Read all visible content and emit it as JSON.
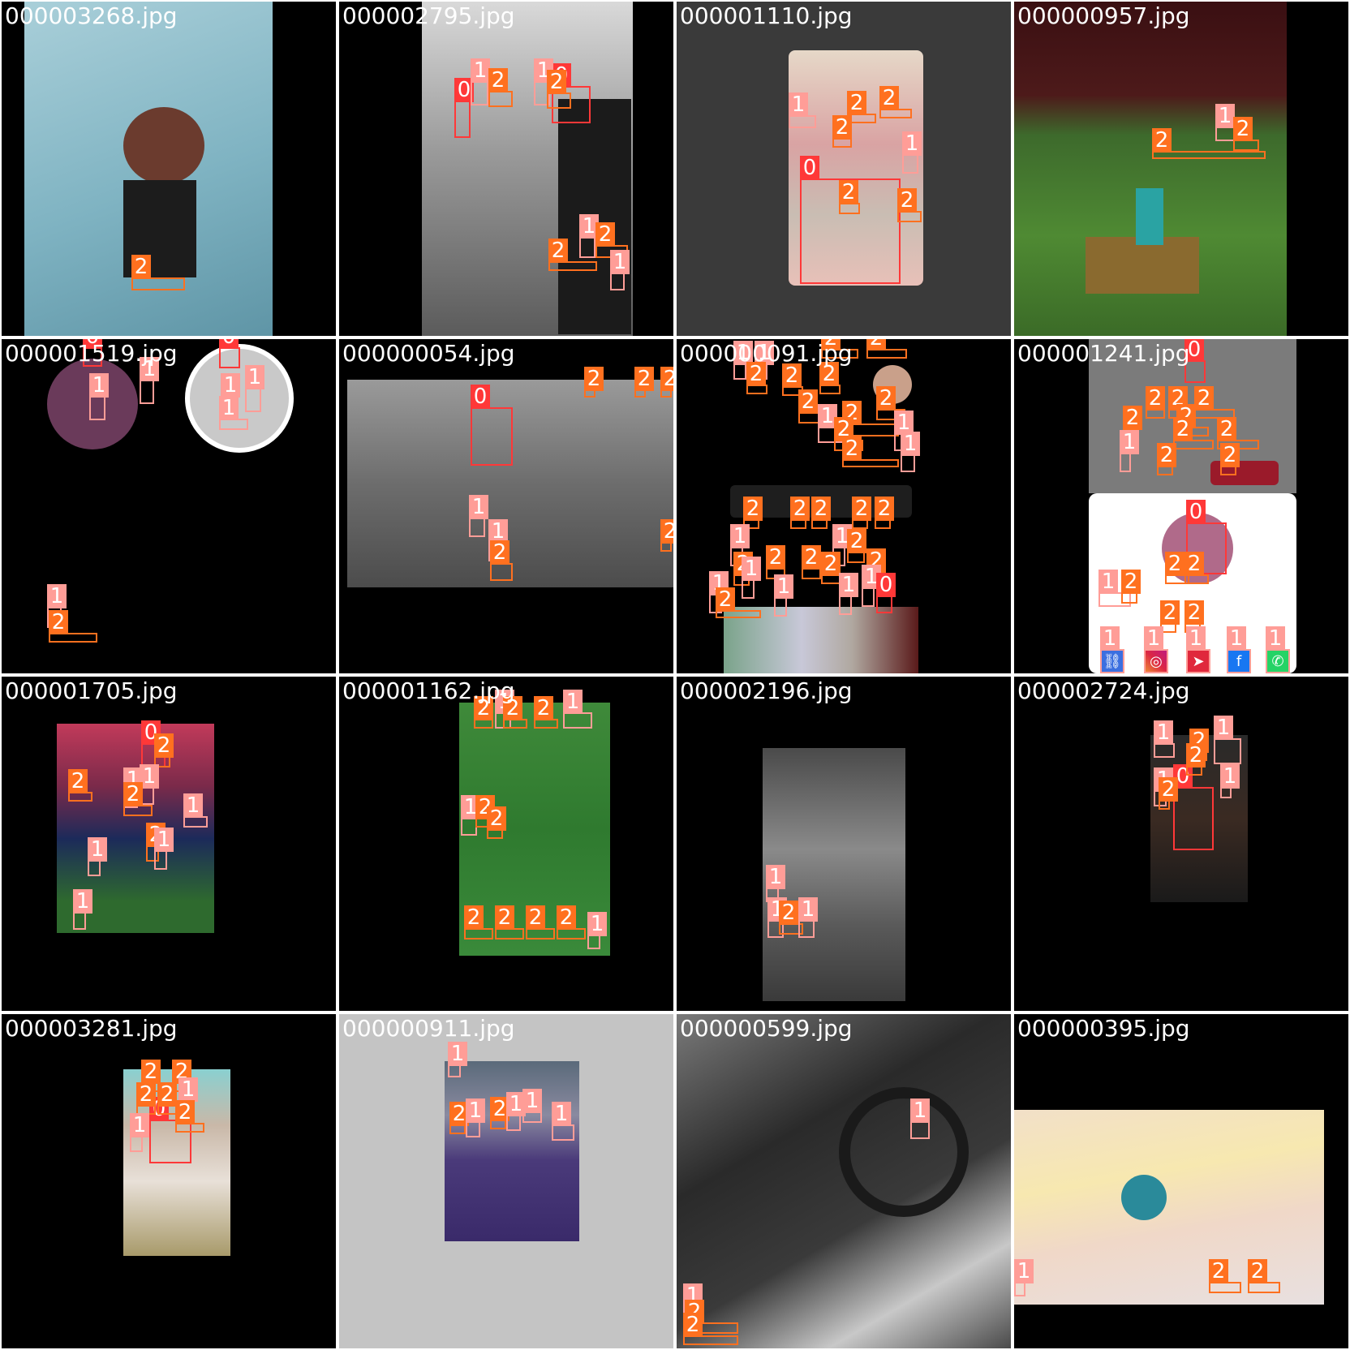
{
  "grid": {
    "tiles": [
      {
        "filename": "000003268.jpg"
      },
      {
        "filename": "000002795.jpg"
      },
      {
        "filename": "000001110.jpg"
      },
      {
        "filename": "000000957.jpg"
      },
      {
        "filename": "000001519.jpg"
      },
      {
        "filename": "000000054.jpg"
      },
      {
        "filename": "000000091.jpg"
      },
      {
        "filename": "000001241.jpg"
      },
      {
        "filename": "000001705.jpg"
      },
      {
        "filename": "000001162.jpg"
      },
      {
        "filename": "000002196.jpg"
      },
      {
        "filename": "000002724.jpg"
      },
      {
        "filename": "000003281.jpg"
      },
      {
        "filename": "000000911.jpg"
      },
      {
        "filename": "000000599.jpg"
      },
      {
        "filename": "000000395.jpg"
      }
    ]
  },
  "classes": {
    "0": {
      "label": "0",
      "color": "#ff3838"
    },
    "1": {
      "label": "1",
      "color": "#ff9d97"
    },
    "2": {
      "label": "2",
      "color": "#ff701f"
    }
  },
  "share_icons": [
    "link-icon",
    "instagram-icon",
    "direct-message-icon",
    "facebook-icon",
    "whatsapp-icon"
  ]
}
